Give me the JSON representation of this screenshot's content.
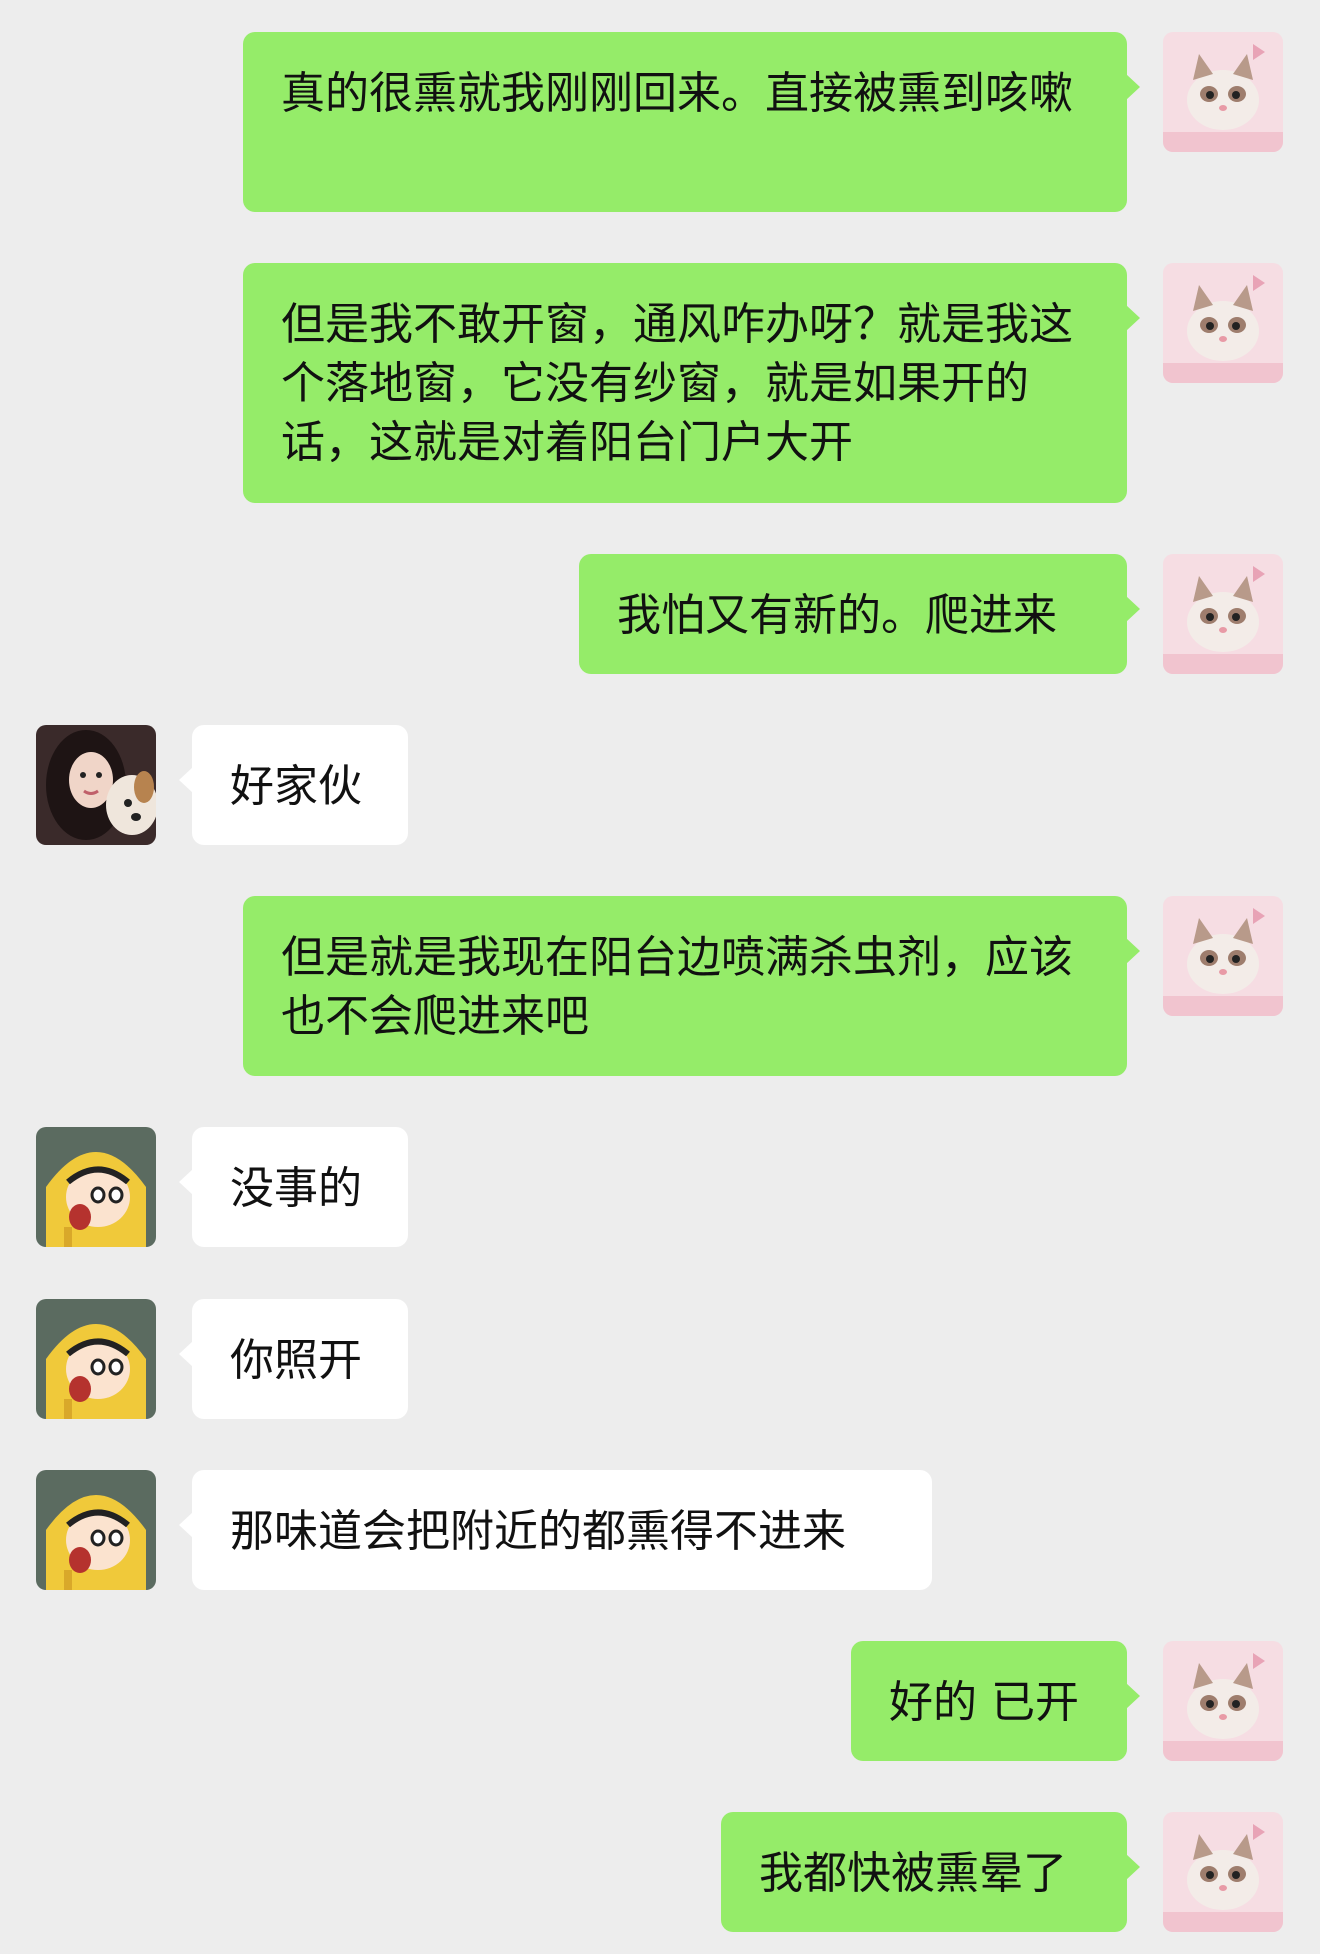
{
  "colors": {
    "background": "#ededed",
    "sent_bubble": "#95ec69",
    "received_bubble": "#ffffff"
  },
  "messages": [
    {
      "side": "right",
      "sender": "me",
      "avatar": "kitten-avatar",
      "text": "真的很熏就我刚刚回来。直接被熏到咳嗽"
    },
    {
      "side": "right",
      "sender": "me",
      "avatar": "kitten-avatar",
      "text": "但是我不敢开窗，通风咋办呀？就是我这个落地窗，它没有纱窗，就是如果开的话，这就是对着阳台门户大开"
    },
    {
      "side": "right",
      "sender": "me",
      "avatar": "kitten-avatar",
      "text": "我怕又有新的。爬进来"
    },
    {
      "side": "left",
      "sender": "friend-a",
      "avatar": "woman-with-dog-avatar",
      "text": "好家伙"
    },
    {
      "side": "right",
      "sender": "me",
      "avatar": "kitten-avatar",
      "text": "但是就是我现在阳台边喷满杀虫剂，应该也不会爬进来吧"
    },
    {
      "side": "left",
      "sender": "friend-b",
      "avatar": "cartoon-boy-raincoat-avatar",
      "text": "没事的"
    },
    {
      "side": "left",
      "sender": "friend-b",
      "avatar": "cartoon-boy-raincoat-avatar",
      "text": "你照开"
    },
    {
      "side": "left",
      "sender": "friend-b",
      "avatar": "cartoon-boy-raincoat-avatar",
      "text": "那味道会把附近的都熏得不进来"
    },
    {
      "side": "right",
      "sender": "me",
      "avatar": "kitten-avatar",
      "text": "好的 已开"
    },
    {
      "side": "right",
      "sender": "me",
      "avatar": "kitten-avatar",
      "text": "我都快被熏晕了"
    }
  ]
}
